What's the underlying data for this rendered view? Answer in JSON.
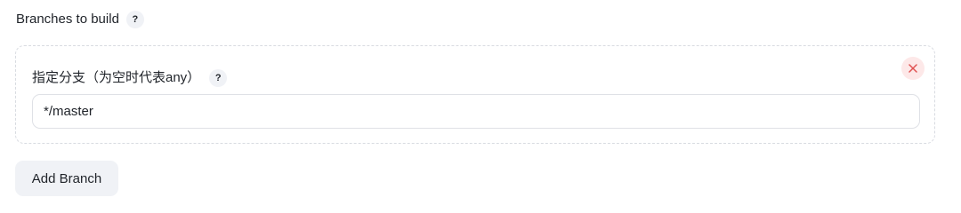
{
  "section": {
    "title": "Branches to build",
    "help_glyph": "?"
  },
  "branch_item": {
    "label": "指定分支（为空时代表any）",
    "help_glyph": "?",
    "value": "*/master",
    "delete_icon": "close-icon",
    "delete_color": "#e05252"
  },
  "add_button": {
    "label": "Add Branch"
  }
}
